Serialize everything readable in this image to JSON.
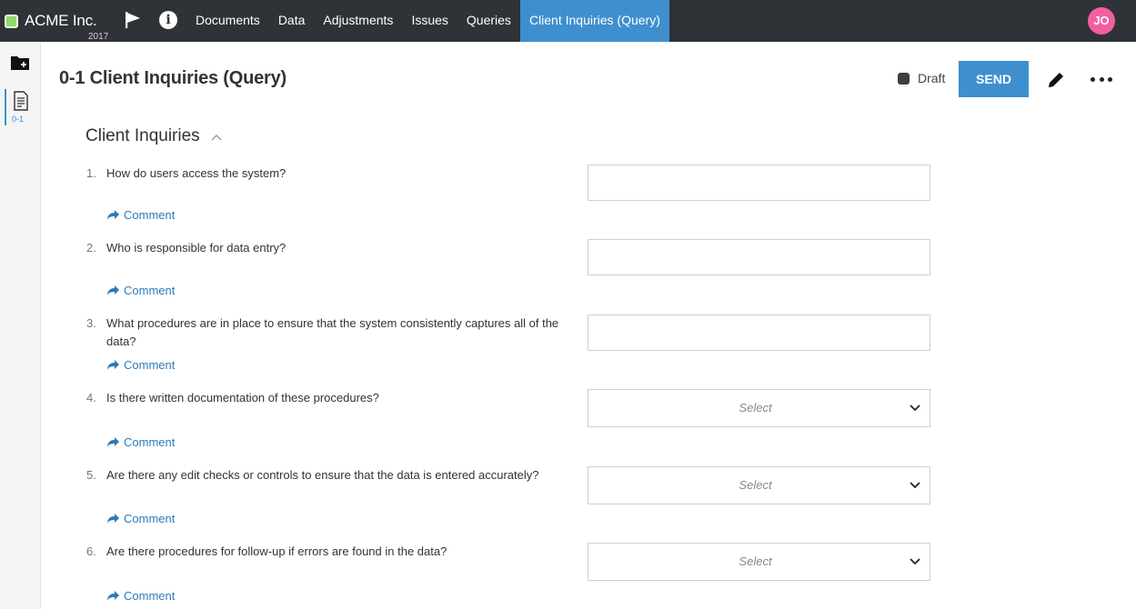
{
  "app": {
    "name": "ACME Inc.",
    "year": "2017"
  },
  "nav": {
    "items": [
      {
        "label": "Documents"
      },
      {
        "label": "Data"
      },
      {
        "label": "Adjustments"
      },
      {
        "label": "Issues"
      },
      {
        "label": "Queries"
      },
      {
        "label": "Client Inquiries (Query)",
        "active": true
      }
    ]
  },
  "user": {
    "initials": "JO",
    "avatar_color": "#f25fa0"
  },
  "rail": {
    "doc_label": "0-1"
  },
  "page": {
    "title": "0-1 Client Inquiries (Query)",
    "status": "Draft",
    "send_label": "SEND"
  },
  "section": {
    "title": "Client Inquiries"
  },
  "questions": [
    {
      "num": "1.",
      "text": "How do users access the system?",
      "answer_type": "text",
      "value": "",
      "comment": "Comment"
    },
    {
      "num": "2.",
      "text": "Who is responsible for data entry?",
      "answer_type": "text",
      "value": "",
      "comment": "Comment"
    },
    {
      "num": "3.",
      "text": "What procedures are in place to ensure that the system consistently captures all of the data?",
      "answer_type": "text",
      "value": "",
      "comment": "Comment"
    },
    {
      "num": "4.",
      "text": "Is there written documentation of these procedures?",
      "answer_type": "select",
      "placeholder": "Select",
      "comment": "Comment"
    },
    {
      "num": "5.",
      "text": "Are there any edit checks or controls to ensure that the data is entered accurately?",
      "answer_type": "select",
      "placeholder": "Select",
      "comment": "Comment"
    },
    {
      "num": "6.",
      "text": "Are there procedures for follow-up if errors are found in the data?",
      "answer_type": "select",
      "placeholder": "Select",
      "comment": "Comment"
    }
  ],
  "colors": {
    "topbar": "#2f3237",
    "accent": "#3f8fcf",
    "link": "#2d7ab9",
    "brand_dot": "#8fd96a"
  }
}
